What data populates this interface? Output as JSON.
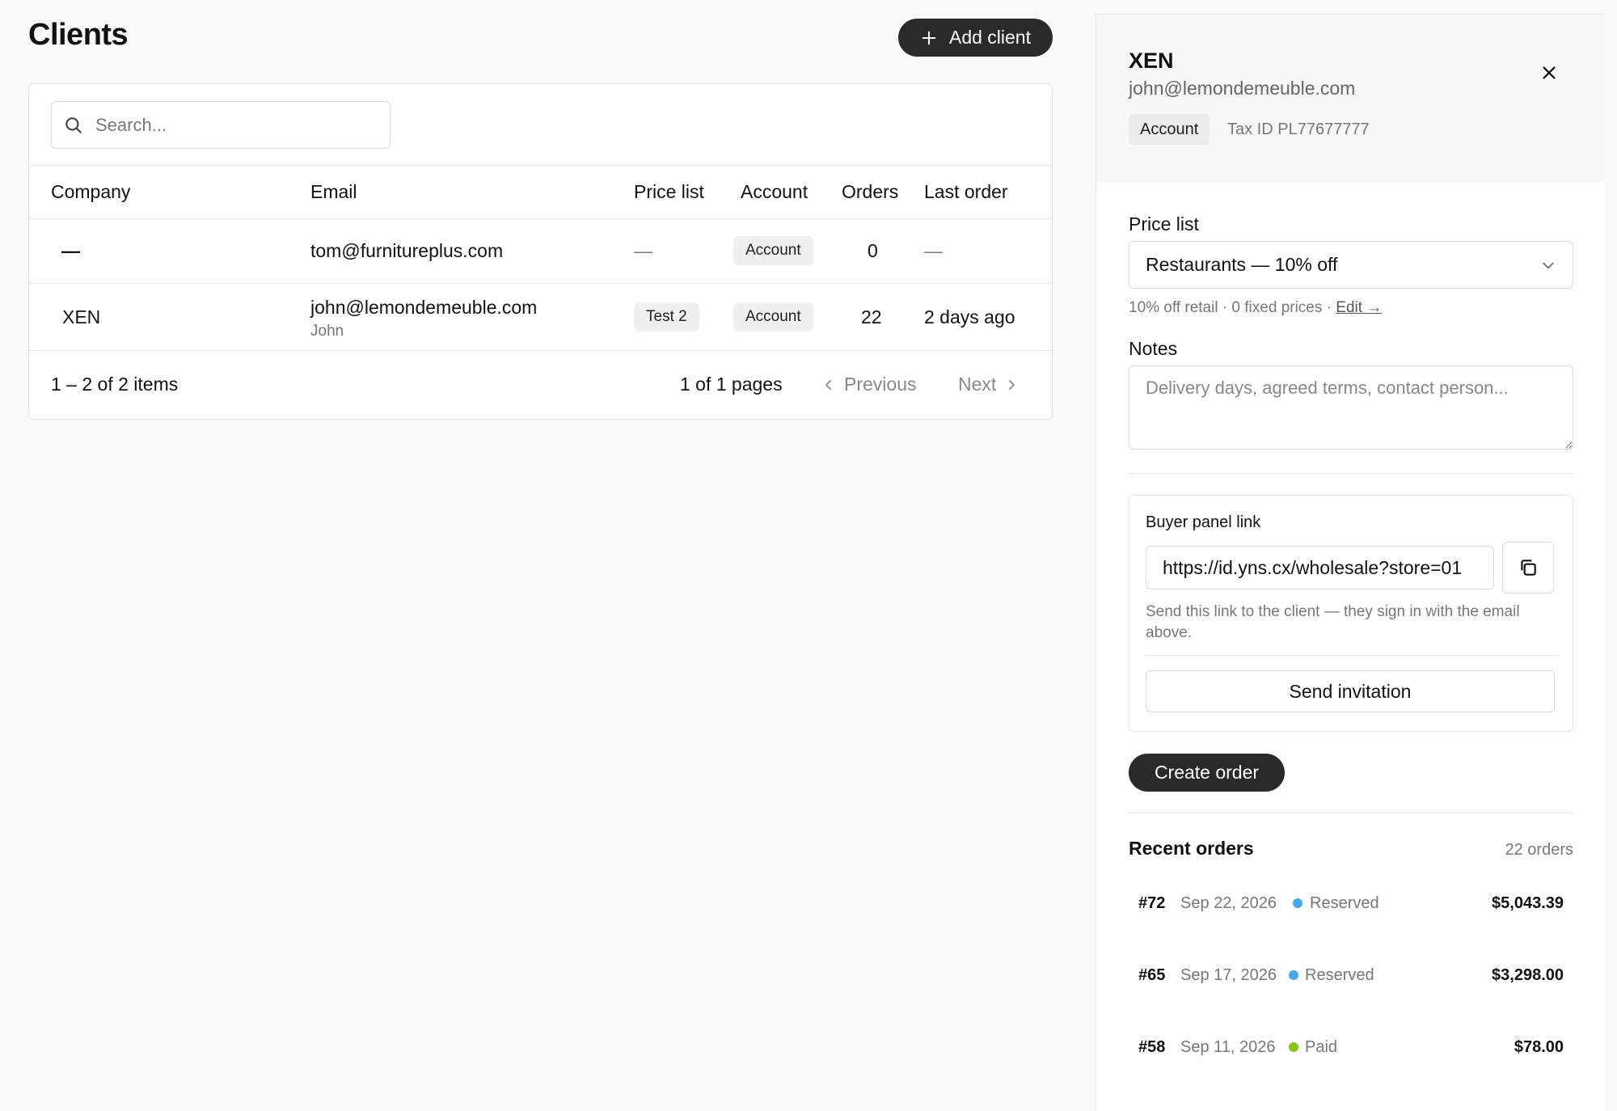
{
  "page": {
    "title": "Clients",
    "add_button": "Add client"
  },
  "search": {
    "placeholder": "Search..."
  },
  "table": {
    "columns": [
      "Company",
      "Email",
      "Price list",
      "Account",
      "Orders",
      "Last order"
    ],
    "rows": [
      {
        "company": "—",
        "email": "tom@furnitureplus.com",
        "contact": "",
        "price_list": "—",
        "account": "Account",
        "orders": "0",
        "last_order": "—"
      },
      {
        "company": "XEN",
        "email": "john@lemondemeuble.com",
        "contact": "John",
        "price_list": "Test 2",
        "account": "Account",
        "orders": "22",
        "last_order": "2 days ago"
      }
    ],
    "footer": {
      "items": "1 – 2 of 2 items",
      "pages": "1 of 1 pages",
      "previous": "Previous",
      "next": "Next"
    }
  },
  "panel": {
    "name": "XEN",
    "email": "john@lemondemeuble.com",
    "badge": "Account",
    "tax_id": "Tax ID PL77677777",
    "price_list_label": "Price list",
    "price_list_value": "Restaurants — 10% off",
    "price_list_helper": "10% off retail · 0 fixed prices · ",
    "edit_link": "Edit →",
    "notes_label": "Notes",
    "notes_placeholder": "Delivery days, agreed terms, contact person...",
    "buyer_link": {
      "title": "Buyer panel link",
      "url": "https://id.yns.cx/wholesale?store=01",
      "help": "Send this link to the client — they sign in with the email above.",
      "invite_button": "Send invitation"
    },
    "create_order_button": "Create order",
    "recent_orders": {
      "title": "Recent orders",
      "count": "22 orders",
      "items": [
        {
          "number": "#72",
          "date": "Sep 22, 2026",
          "status": "Reserved",
          "status_color": "#4aa8e8",
          "amount": "$5,043.39"
        },
        {
          "number": "#65",
          "date": "Sep 17, 2026",
          "status": "Reserved",
          "status_color": "#4aa8e8",
          "amount": "$3,298.00"
        },
        {
          "number": "#58",
          "date": "Sep 11, 2026",
          "status": "Paid",
          "status_color": "#8cc21e",
          "amount": "$78.00"
        }
      ]
    }
  }
}
